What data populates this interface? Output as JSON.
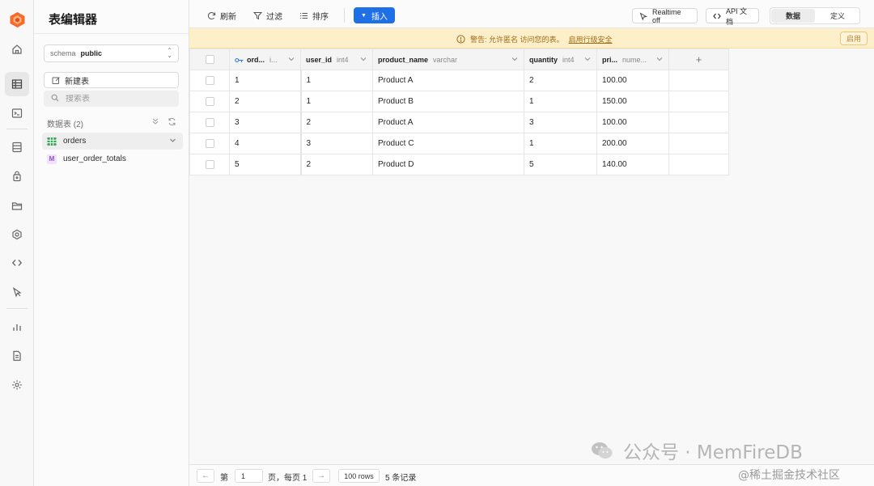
{
  "rail": {
    "items": [
      "home-icon",
      "table-editor-icon",
      "sql-editor-icon",
      "database-icon",
      "auth-icon",
      "storage-icon",
      "functions-icon",
      "api-icon",
      "logs-icon",
      "reports-icon",
      "docs-icon",
      "settings-icon"
    ]
  },
  "sidebar": {
    "title": "表编辑器",
    "schema_label": "schema",
    "schema_value": "public",
    "new_table": "新建表",
    "search_placeholder": "搜索表",
    "group_label": "数据表 (2)",
    "tables": [
      {
        "name": "orders",
        "type": "table",
        "active": true
      },
      {
        "name": "user_order_totals",
        "type": "view",
        "badge": "M",
        "active": false
      }
    ]
  },
  "toolbar": {
    "refresh": "刷新",
    "filter": "过滤",
    "sort": "排序",
    "insert": "插入",
    "realtime": "Realtime off",
    "api_docs": "API 文档",
    "tab_data": "数据",
    "tab_definition": "定义"
  },
  "warning": {
    "text": "警告: 允许匿名 访问您的表。",
    "link": "启用行级安全",
    "button": "启用"
  },
  "grid": {
    "columns": [
      {
        "name": "ord...",
        "type": "i...",
        "key": true
      },
      {
        "name": "user_id",
        "type": "int4"
      },
      {
        "name": "product_name",
        "type": "varchar"
      },
      {
        "name": "quantity",
        "type": "int4"
      },
      {
        "name": "pri...",
        "type": "nume..."
      }
    ],
    "add_column": "+",
    "rows": [
      [
        "1",
        "1",
        "Product A",
        "2",
        "100.00"
      ],
      [
        "2",
        "1",
        "Product B",
        "1",
        "150.00"
      ],
      [
        "3",
        "2",
        "Product A",
        "3",
        "100.00"
      ],
      [
        "4",
        "3",
        "Product C",
        "1",
        "200.00"
      ],
      [
        "5",
        "2",
        "Product D",
        "5",
        "140.00"
      ]
    ]
  },
  "footer": {
    "prev": "←",
    "page_prefix": "第",
    "page_value": "1",
    "page_suffix": "页，每页 1",
    "next": "→",
    "rows_per_page": "100 rows",
    "record_count": "5 条记录"
  },
  "watermark": {
    "wechat": "公众号 · MemFireDB",
    "juejin": "@稀土掘金技术社区"
  },
  "colors": {
    "accent": "#1f6fe6",
    "warning_bg": "#fcefc9",
    "warning_text": "#a06b15",
    "logo": "#f26b2a"
  }
}
